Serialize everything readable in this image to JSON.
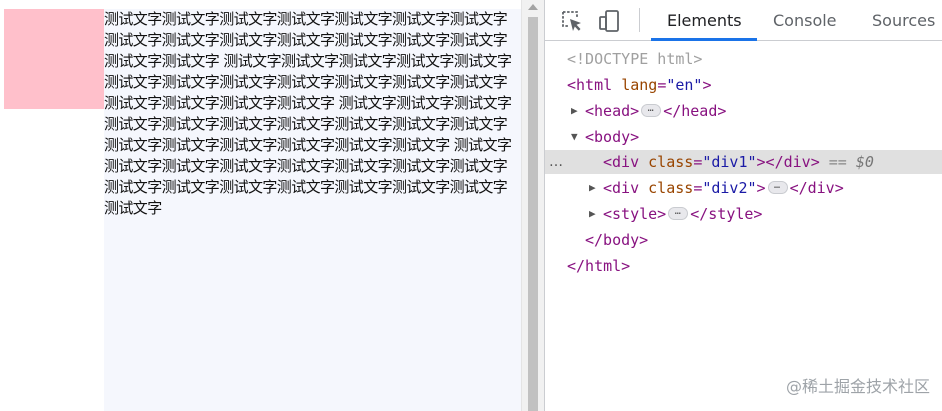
{
  "page_preview": {
    "div2_text": "测试文字测试文字测试文字测试文字测试文字测试文字测试文字测试文字测试文字测试文字测试文字测试文字测试文字测试文字测试文字测试文字 测试文字测试文字测试文字测试文字测试文字测试文字测试文字测试文字测试文字测试文字测试文字测试文字测试文字测试文字测试文字测试文字 测试文字测试文字测试文字测试文字测试文字测试文字测试文字测试文字测试文字测试文字测试文字测试文字测试文字测试文字测试文字测试文字 测试文字测试文字测试文字测试文字测试文字测试文字测试文字测试文字测试文字测试文字测试文字测试文字测试文字测试文字测试文字测试文字",
    "div1_color": "#ffc0cb",
    "div2_color": "#f5f7fd"
  },
  "devtools": {
    "toolbar": {
      "inspect_icon": "inspect-element-icon",
      "device_icon": "device-toolbar-icon"
    },
    "tabs": [
      {
        "label": "Elements",
        "active": true
      },
      {
        "label": "Console",
        "active": false
      },
      {
        "label": "Sources",
        "active": false
      }
    ],
    "dom": {
      "doctype": "<!DOCTYPE html>",
      "html_open": {
        "tag": "<html",
        "attr": "lang",
        "value": "\"en\"",
        "close": ">"
      },
      "head": {
        "open": "<head>",
        "close": "</head>"
      },
      "body_open": "<body>",
      "div1": {
        "open": "<div",
        "attr": "class",
        "value": "\"div1\"",
        "mid": "></div>",
        "eq": "==",
        "ref": "$0"
      },
      "div2": {
        "open": "<div",
        "attr": "class",
        "value": "\"div2\"",
        "mid": ">",
        "close": "</div>"
      },
      "style": {
        "open": "<style>",
        "close": "</style>"
      },
      "body_close": "</body>",
      "html_close": "</html>"
    },
    "ellipsis": "…",
    "row_dots": "…",
    "accent_color": "#1a73e8"
  },
  "watermark": "@稀土掘金技术社区"
}
